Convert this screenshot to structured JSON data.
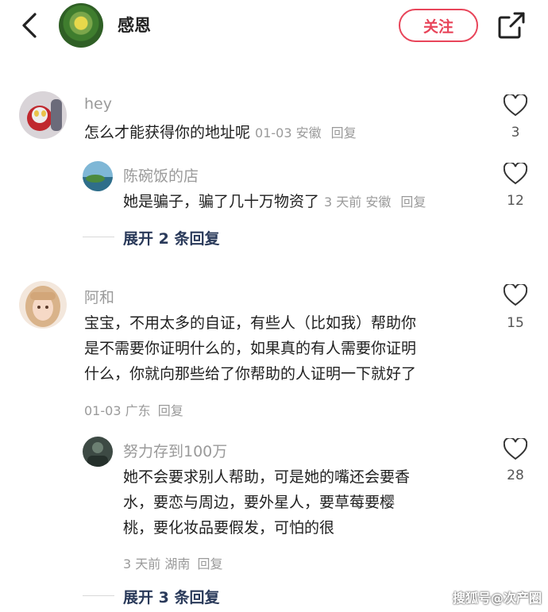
{
  "header": {
    "title": "感恩",
    "follow_label": "关注",
    "back_icon": "back-arrow-icon",
    "share_icon": "share-icon"
  },
  "colors": {
    "accent": "#e8455a",
    "meta": "#9a9a9a",
    "expand": "#2a3a5a"
  },
  "comments": [
    {
      "username": "hey",
      "text": "怎么才能获得你的地址呢",
      "meta": "01-03 安徽",
      "reply_label": "回复",
      "likes": "3",
      "replies": [
        {
          "username": "陈碗饭的店",
          "text": "她是骗子，骗了几十万物资了",
          "meta": "3 天前 安徽",
          "reply_label": "回复",
          "likes": "12"
        }
      ],
      "expand_label": "展开 2 条回复"
    },
    {
      "username": "阿和",
      "text_lines": [
        "宝宝，不用太多的自证，有些人（比如我）帮助你",
        "是不需要你证明什么的，如果真的有人需要你证明",
        "什么，你就向那些给了你帮助的人证明一下就好了"
      ],
      "meta": "01-03 广东",
      "reply_label": "回复",
      "likes": "15",
      "replies": [
        {
          "username": "努力存到100万",
          "text_lines": [
            "她不会要求别人帮助，可是她的嘴还会要香",
            "水，要恋与周边，要外星人，要草莓要樱",
            "桃，要化妆品要假发，可怕的很"
          ],
          "meta": "3 天前 湖南",
          "reply_label": "回复",
          "likes": "28"
        }
      ],
      "expand_label": "展开 3 条回复"
    }
  ],
  "watermark": "搜狐号@次产圈"
}
